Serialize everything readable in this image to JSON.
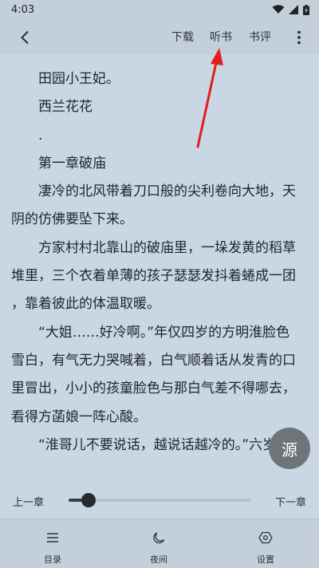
{
  "status_bar": {
    "time": "4:03",
    "icons": [
      "wifi-icon",
      "signal-icon",
      "battery-icon"
    ]
  },
  "top_bar": {
    "back_icon": "back-arrow-icon",
    "download_label": "下载",
    "listen_label": "听书",
    "review_label": "书评",
    "more_icon": "more-vertical-icon"
  },
  "content": {
    "lines": [
      "　　田园小王妃。",
      "　　西兰花花",
      "　　.",
      "　　第一章破庙",
      "　　凄冷的北风带着刀口般的尖利卷向大地，天",
      "阴的仿佛要坠下来。",
      "　　方家村村北靠山的破庙里，一垛发黄的稻草",
      "堆里，三个衣着单薄的孩子瑟瑟发抖着蜷成一团",
      "，靠着彼此的体温取暖。",
      "　　“大姐……好冷啊。”年仅四岁的方明淮脸色",
      "雪白，有气无力哭喊着，白气顺着话从发青的口",
      "里冒出，小小的孩童脸色与那白气差不得哪去，",
      "看得方菡娘一阵心酸。",
      "　　“淮哥儿不要说话，越说话越冷的。”六岁的"
    ]
  },
  "source_button": {
    "label": "源"
  },
  "chapter_bar": {
    "prev_label": "上一章",
    "next_label": "下一章",
    "progress": 0.11
  },
  "bottom_nav": {
    "items": [
      {
        "label": "目录",
        "icon": "menu-list-icon"
      },
      {
        "label": "夜间",
        "icon": "moon-icon"
      },
      {
        "label": "设置",
        "icon": "settings-icon"
      }
    ]
  },
  "colors": {
    "background": "#c9d6e3",
    "bar": "#c3d0dc",
    "source_button": "#6f7479",
    "annotation_arrow": "#e0201d"
  }
}
